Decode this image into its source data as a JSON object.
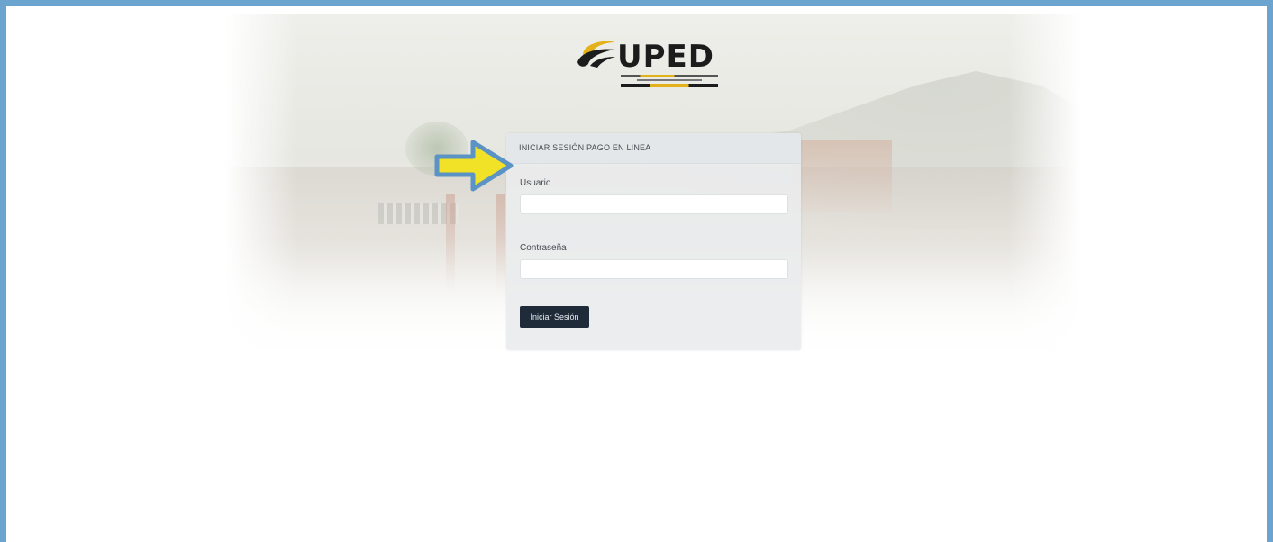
{
  "logo": {
    "text": "UPED",
    "brand_colors": {
      "accent": "#e3b21a",
      "text": "#1c1c1c"
    },
    "icon": "uped-swoosh-logo"
  },
  "login": {
    "header": "INICIAR SESIÓN PAGO EN LINEA",
    "username_label": "Usuario",
    "username_value": "",
    "password_label": "Contraseña",
    "password_value": "",
    "submit_label": "Iniciar Sesión",
    "submit_color": "#1f2b39"
  },
  "annotation": {
    "icon": "arrow-right-icon",
    "color": "#f2e227",
    "outline_color": "#5b93c4"
  },
  "frame": {
    "border_color": "#6aa4cf"
  }
}
